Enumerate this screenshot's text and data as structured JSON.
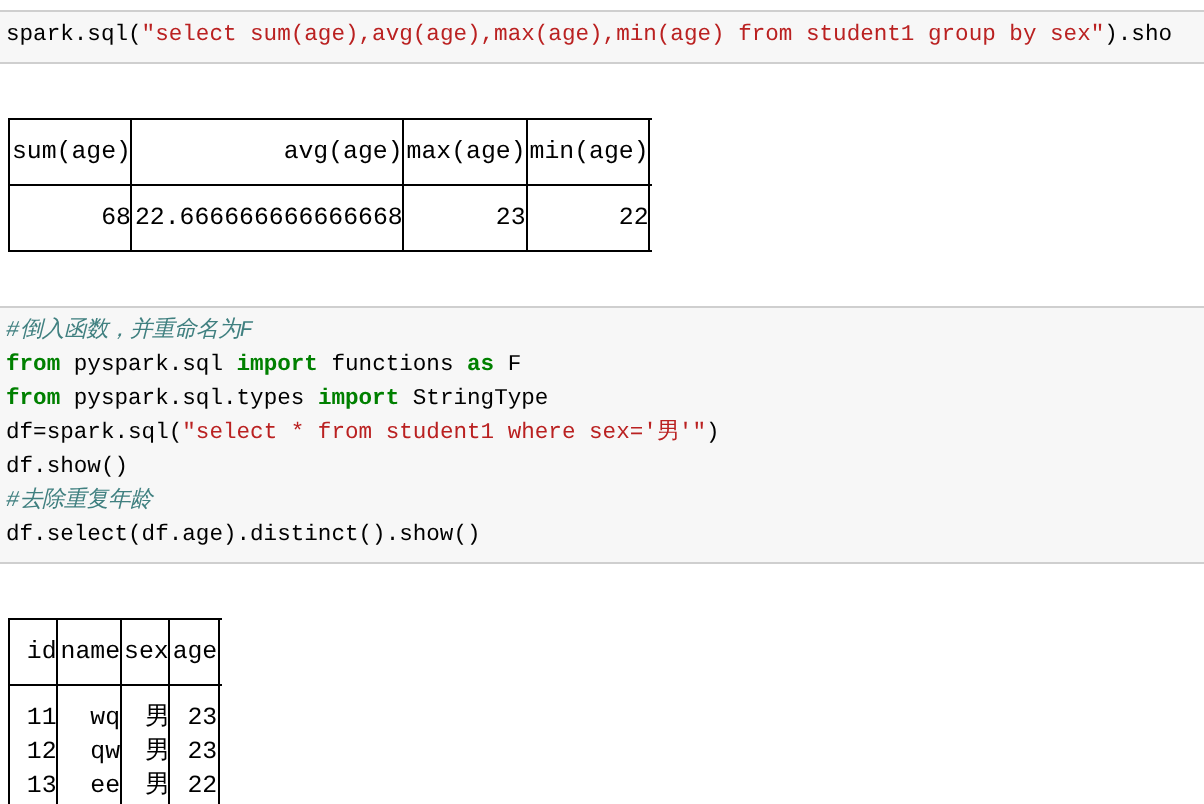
{
  "cells": [
    {
      "kind": "code",
      "lines": [
        [
          {
            "kind": "plain",
            "text": "spark.sql("
          },
          {
            "kind": "string",
            "text": "\"select sum(age),avg(age),max(age),min(age) from student1 group by sex\""
          },
          {
            "kind": "plain",
            "text": ").sho"
          }
        ]
      ]
    },
    {
      "kind": "output",
      "table": {
        "columns": [
          "sum(age)",
          "avg(age)",
          "max(age)",
          "min(age)"
        ],
        "rows": [
          [
            "68",
            "22.666666666666668",
            "23",
            "22"
          ]
        ]
      }
    },
    {
      "kind": "code",
      "lines": [
        [
          {
            "kind": "comment",
            "text": "#倒入函数，并重命名为F"
          }
        ],
        [
          {
            "kind": "keyword",
            "text": "from"
          },
          {
            "kind": "plain",
            "text": " pyspark.sql "
          },
          {
            "kind": "keyword",
            "text": "import"
          },
          {
            "kind": "plain",
            "text": " functions "
          },
          {
            "kind": "keyword",
            "text": "as"
          },
          {
            "kind": "plain",
            "text": " F"
          }
        ],
        [
          {
            "kind": "keyword",
            "text": "from"
          },
          {
            "kind": "plain",
            "text": " pyspark.sql.types "
          },
          {
            "kind": "keyword",
            "text": "import"
          },
          {
            "kind": "plain",
            "text": " StringType"
          }
        ],
        [
          {
            "kind": "plain",
            "text": "df=spark.sql("
          },
          {
            "kind": "string",
            "text": "\"select * from student1 where sex='男'\""
          },
          {
            "kind": "plain",
            "text": ")"
          }
        ],
        [
          {
            "kind": "plain",
            "text": "df.show()"
          }
        ],
        [
          {
            "kind": "comment",
            "text": "#去除重复年龄"
          }
        ],
        [
          {
            "kind": "plain",
            "text": "df.select(df.age).distinct().show()"
          }
        ]
      ]
    },
    {
      "kind": "output",
      "table": {
        "columns": [
          "id",
          "name",
          "sex",
          "age"
        ],
        "rows": [
          [
            "11",
            "wq",
            "男",
            "23"
          ],
          [
            "12",
            "qw",
            "男",
            "23"
          ],
          [
            "13",
            "ee",
            "男",
            "22"
          ]
        ]
      }
    }
  ]
}
